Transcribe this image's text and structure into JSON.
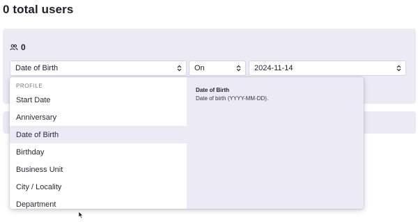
{
  "page": {
    "title": "0 total users"
  },
  "filter": {
    "count": "0",
    "field_select": {
      "value": "Date of Birth"
    },
    "operator_select": {
      "value": "On"
    },
    "date_select": {
      "value": "2024-11-14"
    }
  },
  "dropdown": {
    "group_label": "PROFILE",
    "items": [
      {
        "label": "Start Date"
      },
      {
        "label": "Anniversary"
      },
      {
        "label": "Date of Birth",
        "selected": true
      },
      {
        "label": "Birthday"
      },
      {
        "label": "Business Unit"
      },
      {
        "label": "City / Locality"
      },
      {
        "label": "Department"
      }
    ],
    "detail": {
      "title": "Date of Birth",
      "description": "Date of birth (YYYY-MM-DD)."
    }
  },
  "icons": {
    "users": "users-icon",
    "chevron": "chevron-up-down-icon",
    "cursor": "mouse-pointer-icon"
  },
  "colors": {
    "panel": "#ecebf5",
    "selected_item": "#ecebf5",
    "text": "#1f1f2b"
  }
}
